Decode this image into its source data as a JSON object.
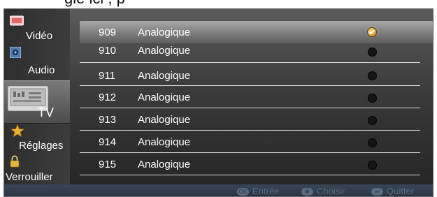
{
  "caption": "gle ici , p",
  "sidebar": {
    "items": [
      {
        "label": "Vidéo",
        "icon": "video-icon"
      },
      {
        "label": "Audio",
        "icon": "audio-icon"
      },
      {
        "label": "TV",
        "icon": "tv-icon"
      },
      {
        "label": "Réglages",
        "icon": "settings-star-icon"
      },
      {
        "label": "Verrouiller",
        "icon": "lock-icon"
      }
    ],
    "active": "TV"
  },
  "channels": [
    {
      "number": "909",
      "name": "Analogique",
      "status": "checked"
    },
    {
      "number": "910",
      "name": "Analogique",
      "status": "off"
    },
    {
      "number": "911",
      "name": "Analogique",
      "status": "off"
    },
    {
      "number": "912",
      "name": "Analogique",
      "status": "off"
    },
    {
      "number": "913",
      "name": "Analogique",
      "status": "off"
    },
    {
      "number": "914",
      "name": "Analogique",
      "status": "off"
    },
    {
      "number": "915",
      "name": "Analogique",
      "status": "off"
    }
  ],
  "footer": {
    "enter": {
      "key": "OK",
      "label": "Entrée"
    },
    "choose": {
      "key": "✥",
      "label": "Choisir"
    },
    "quit": {
      "key": "↩",
      "label": "Quitter"
    }
  },
  "colors": {
    "selected_check": "#d4a020",
    "dot": "#141414",
    "footer_text": "#5a6a80"
  }
}
